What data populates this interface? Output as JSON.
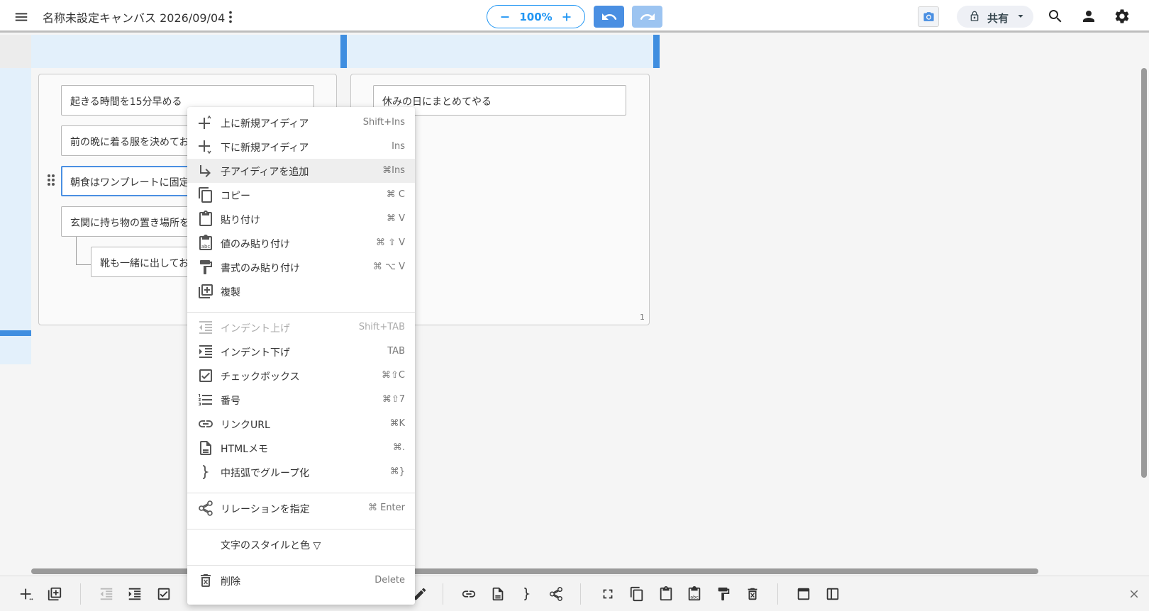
{
  "header": {
    "title": "名称未設定キャンバス 2026/09/04",
    "zoom": "100%",
    "share_label": "共有"
  },
  "canvas": {
    "left_card": {
      "nodes": [
        "起きる時間を15分早める",
        "前の晩に着る服を決めてお",
        "朝食はワンプレートに固定",
        "玄関に持ち物の置き場所を",
        "靴も一緒に出してお"
      ]
    },
    "right_card": {
      "nodes": [
        "休みの日にまとめてやる"
      ],
      "page_number": "1"
    }
  },
  "context_menu": {
    "items": [
      {
        "label": "上に新規アイディア",
        "shortcut": "Shift+Ins"
      },
      {
        "label": "下に新規アイディア",
        "shortcut": "Ins"
      },
      {
        "label": "子アイディアを追加",
        "shortcut": "⌘Ins"
      },
      {
        "label": "コピー",
        "shortcut": "⌘ C"
      },
      {
        "label": "貼り付け",
        "shortcut": "⌘ V"
      },
      {
        "label": "値のみ貼り付け",
        "shortcut": "⌘ ⇧ V"
      },
      {
        "label": "書式のみ貼り付け",
        "shortcut": "⌘ ⌥ V"
      },
      {
        "label": "複製",
        "shortcut": ""
      },
      {
        "label": "インデント上げ",
        "shortcut": "Shift+TAB"
      },
      {
        "label": "インデント下げ",
        "shortcut": "TAB"
      },
      {
        "label": "チェックボックス",
        "shortcut": "⌘⇧C"
      },
      {
        "label": "番号",
        "shortcut": "⌘⇧7"
      },
      {
        "label": "リンクURL",
        "shortcut": "⌘K"
      },
      {
        "label": "HTMLメモ",
        "shortcut": "⌘."
      },
      {
        "label": "中括弧でグループ化",
        "shortcut": "⌘}"
      },
      {
        "label": "リレーションを指定",
        "shortcut": "⌘ Enter"
      },
      {
        "label": "文字のスタイルと色 ▽",
        "shortcut": ""
      },
      {
        "label": "削除",
        "shortcut": "Delete"
      }
    ]
  },
  "colors": {
    "accent": "#2196f3",
    "lane_bar": "#3f8ee0",
    "lane_header": "#e3f0fb"
  },
  "icons": [
    "menu-icon",
    "more-vert-icon",
    "zoom-out-icon",
    "zoom-in-icon",
    "undo-icon",
    "redo-icon",
    "camera-icon",
    "lock-icon",
    "search-icon",
    "account-icon",
    "settings-icon",
    "close-icon"
  ]
}
